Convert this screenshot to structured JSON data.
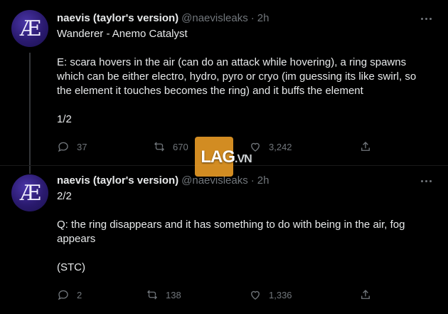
{
  "tweets": [
    {
      "author_name": "naevis (taylor's version)",
      "handle": "@naevisleaks",
      "dot": "·",
      "time": "2h",
      "avatar_glyph": "Æ",
      "body": [
        "Wanderer - Anemo Catalyst",
        "",
        "E: scara hovers in the air (can do an attack while hovering), a ring spawns which can be either electro, hydro, pyro or cryo (im guessing its like swirl, so the element it touches becomes the ring) and it buffs the element",
        "",
        "1/2"
      ],
      "replies": "37",
      "retweets": "670",
      "likes": "3,242"
    },
    {
      "author_name": "naevis (taylor's version)",
      "handle": "@naevisleaks",
      "dot": "·",
      "time": "2h",
      "avatar_glyph": "Æ",
      "body": [
        "2/2",
        "",
        "Q: the ring disappears and it has something to do with being in the air, fog appears",
        "",
        "(STC)"
      ],
      "replies": "2",
      "retweets": "138",
      "likes": "1,336"
    }
  ],
  "watermark": {
    "main": "LAG",
    "sub": ".VN"
  },
  "icons": [
    "reply-icon",
    "retweet-icon",
    "like-icon",
    "share-icon",
    "more-icon"
  ],
  "colors": {
    "background": "#000000",
    "text": "#e7e9ea",
    "muted": "#71767b",
    "avatar": "#2a1a6e"
  }
}
